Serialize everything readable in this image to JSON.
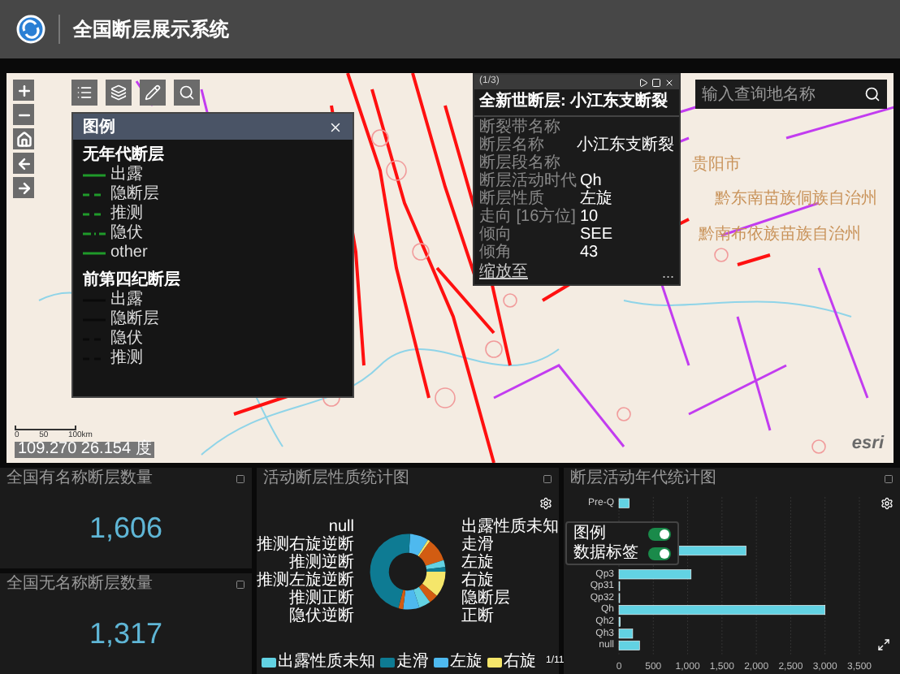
{
  "header": {
    "title": "全国断层展示系统"
  },
  "map": {
    "legend": {
      "title": "图例",
      "groups": [
        {
          "title": "无年代断层",
          "color": "#1f9a2a",
          "items": [
            {
              "label": "出露",
              "kind": "solid"
            },
            {
              "label": "隐断层",
              "kind": "dashed"
            },
            {
              "label": "推测",
              "kind": "dashed"
            },
            {
              "label": "隐伏",
              "kind": "dashdot"
            },
            {
              "label": "other",
              "kind": "solid"
            }
          ]
        },
        {
          "title": "前第四纪断层",
          "color": "#0a0a0a",
          "items": [
            {
              "label": "出露",
              "kind": "solid"
            },
            {
              "label": "隐断层",
              "kind": "solid"
            },
            {
              "label": "隐伏",
              "kind": "dashed"
            },
            {
              "label": "推测",
              "kind": "dashed"
            }
          ]
        }
      ]
    },
    "popup": {
      "counter": "(1/3)",
      "title": "全新世断层: 小江东支断裂",
      "fields": [
        {
          "label": "断裂带名称"
        },
        {
          "label": "断层名称",
          "value": "小江东支断裂"
        },
        {
          "label": "断层段名称"
        },
        {
          "label": "断层活动时代",
          "value": "Qh"
        },
        {
          "label": "断层性质",
          "value": "左旋"
        },
        {
          "label": "走向 [16方位]",
          "value": "10"
        },
        {
          "label": "倾向",
          "value": "SEE"
        },
        {
          "label": "倾角",
          "value": "43"
        }
      ],
      "zoom_link": "缩放至",
      "more": "..."
    },
    "search": {
      "placeholder": "输入查询地名称"
    },
    "place_labels": [
      "贵阳市",
      "黔东南苗族侗族自治州",
      "黔南布依族苗族自治州"
    ],
    "scale_ticks": [
      "0",
      "50",
      "100km"
    ],
    "coordinates": "109.270 26.154 度",
    "attribution": "esri"
  },
  "stats": [
    {
      "title": "全国有名称断层数量",
      "value": "1,606"
    },
    {
      "title": "全国无名称断层数量",
      "value": "1,317"
    }
  ],
  "pie_panel": {
    "title": "活动断层性质统计图",
    "labels_left": [
      "null",
      "推测右旋逆断",
      "推测逆断",
      "推测左旋逆断",
      "推测正断",
      "隐伏逆断"
    ],
    "labels_right": [
      "出露性质未知",
      "走滑",
      "左旋",
      "右旋",
      "隐断层",
      "正断"
    ],
    "legend": [
      {
        "label": "出露性质未知",
        "color": "#62d2e3"
      },
      {
        "label": "走滑",
        "color": "#0e7b93"
      },
      {
        "label": "左旋",
        "color": "#4eb9ef"
      },
      {
        "label": "右旋",
        "color": "#f5e66a"
      }
    ],
    "pager": "1/11"
  },
  "chart_settings": {
    "options": [
      {
        "label": "图例",
        "on": true
      },
      {
        "label": "数据标签",
        "on": true
      }
    ]
  },
  "bar_panel": {
    "title": "断层活动年代统计图",
    "chart_data": {
      "type": "bar",
      "orientation": "horizontal",
      "categories": [
        "Pre-Q",
        null,
        null,
        null,
        null,
        null,
        "Qp3",
        "Qp31",
        "Qp32",
        "Qh",
        "Qh2",
        "Qh3",
        "null"
      ],
      "grid": true,
      "series": [
        {
          "color": "#62d2e3",
          "values": [
            150,
            null,
            null,
            null,
            1850,
            null,
            1050,
            0,
            0,
            3000,
            20,
            200,
            300
          ]
        }
      ],
      "xlim": [
        0,
        3500
      ],
      "xticks": [
        {
          "value": 0,
          "label": "0"
        },
        {
          "value": 500,
          "label": "500"
        },
        {
          "value": 1000,
          "label": "1,000"
        },
        {
          "value": 1500,
          "label": "1,500"
        },
        {
          "value": 2000,
          "label": "2,000"
        },
        {
          "value": 2500,
          "label": "2,500"
        },
        {
          "value": 3000,
          "label": "3,000"
        },
        {
          "value": 3500,
          "label": "3,500"
        }
      ]
    }
  }
}
